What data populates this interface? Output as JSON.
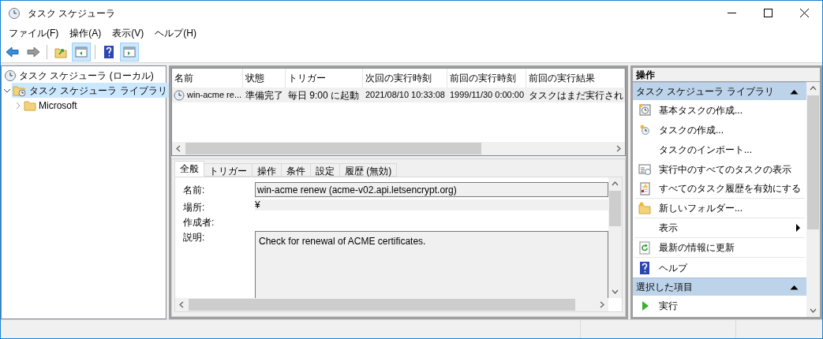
{
  "window": {
    "title": "タスク スケジューラ"
  },
  "menu": [
    "ファイル(F)",
    "操作(A)",
    "表示(V)",
    "ヘルプ(H)"
  ],
  "toolbar": [
    {
      "buttons": [
        {
          "kind": "back",
          "pressed": false
        },
        {
          "kind": "forward",
          "pressed": false
        }
      ]
    },
    {
      "buttons": [
        {
          "kind": "up",
          "pressed": false
        },
        {
          "kind": "tree-pane",
          "pressed": true
        }
      ]
    },
    {
      "buttons": [
        {
          "kind": "help",
          "pressed": false
        },
        {
          "kind": "action-pane",
          "pressed": true
        }
      ]
    }
  ],
  "tree": [
    {
      "label": "タスク スケジューラ (ローカル)",
      "kind": "root",
      "selected": false,
      "children": [
        {
          "label": "タスク スケジューラ ライブラリ",
          "kind": "library",
          "selected": true,
          "expanded": true,
          "children": [
            {
              "label": "Microsoft",
              "kind": "folder",
              "selected": false,
              "expanded": false
            }
          ]
        }
      ]
    }
  ],
  "task_table": {
    "columns": [
      "名前",
      "状態",
      "トリガー",
      "次回の実行時刻",
      "前回の実行時刻",
      "前回の実行結果"
    ],
    "rows": [
      {
        "selected": true,
        "cells": [
          "win-acme re...",
          "準備完了",
          "毎日 9:00 に起動",
          "2021/08/10 10:33:08",
          "1999/11/30 0:00:00",
          "タスクはまだ実行され"
        ]
      }
    ]
  },
  "details": {
    "tabs": [
      {
        "label": "全般",
        "selected": true
      },
      {
        "label": "トリガー",
        "selected": false
      },
      {
        "label": "操作",
        "selected": false
      },
      {
        "label": "条件",
        "selected": false
      },
      {
        "label": "設定",
        "selected": false
      },
      {
        "label": "履歴 (無効)",
        "selected": false
      }
    ],
    "fields": [
      {
        "kind": "textbox",
        "label": "名前:",
        "value": "win-acme renew (acme-v02.api.letsencrypt.org)"
      },
      {
        "kind": "shaded",
        "label": "場所:",
        "value": "¥"
      },
      {
        "kind": "plain",
        "label": "作成者:"
      },
      {
        "kind": "textarea",
        "label": "説明:",
        "value": "Check for renewal of ACME certificates."
      }
    ]
  },
  "actions": {
    "title": "操作",
    "sections": [
      {
        "title": "タスク スケジューラ ライブラリ",
        "expanded": true,
        "items": [
          {
            "label": "基本タスクの作成...",
            "kind": "basic-task",
            "divider": false,
            "submenu": false
          },
          {
            "label": "タスクの作成...",
            "kind": "task",
            "divider": false,
            "submenu": false
          },
          {
            "label": "タスクのインポート...",
            "kind": "none",
            "divider": false,
            "submenu": false
          },
          {
            "label": "実行中のすべてのタスクの表示",
            "kind": "running",
            "divider": false,
            "submenu": false
          },
          {
            "label": "すべてのタスク履歴を有効にする",
            "kind": "history",
            "divider": true,
            "submenu": false
          },
          {
            "label": "新しいフォルダー...",
            "kind": "folder",
            "divider": true,
            "submenu": false
          },
          {
            "label": "表示",
            "kind": "none",
            "divider": true,
            "submenu": true
          },
          {
            "label": "最新の情報に更新",
            "kind": "refresh",
            "divider": true,
            "submenu": false
          },
          {
            "label": "ヘルプ",
            "kind": "help",
            "divider": false,
            "submenu": false
          }
        ]
      },
      {
        "title": "選択した項目",
        "expanded": true,
        "items": [
          {
            "label": "実行",
            "kind": "run",
            "divider": false,
            "submenu": false
          }
        ]
      }
    ]
  }
}
